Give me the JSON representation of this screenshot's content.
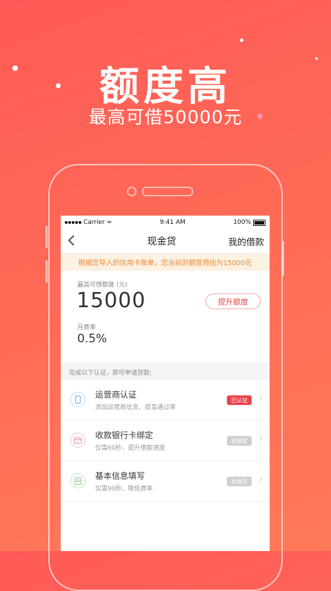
{
  "promo": {
    "headline": "额度高",
    "subline": "最高可借50000元"
  },
  "status_bar": {
    "carrier": "Carrier",
    "time": "9:41 AM",
    "battery": "100%"
  },
  "nav": {
    "back_icon": "chevron-left-icon",
    "title": "现金贷",
    "right_link": "我的借款"
  },
  "notice": "根据您导入的信用卡账单，您当前的额度预估为15000元",
  "quota": {
    "label": "最高可借额度 (元)",
    "amount": "15000",
    "rate_label": "月费率",
    "rate": "0.5%",
    "raise_button": "提升额度"
  },
  "section_hint": "完成以下认证，即可申请贷款:",
  "items": [
    {
      "title": "运营商认证",
      "desc": "添加运营商信息，提高通过率",
      "badge": "已认证",
      "icon": "phone-icon",
      "icon_color": "#5aa9e6",
      "badge_color": "#e8454e"
    },
    {
      "title": "收款银行卡绑定",
      "desc": "仅需60秒，提升借款速度",
      "badge": "未绑定",
      "icon": "bank-card-icon",
      "icon_color": "#e88a8a",
      "badge_color": "#cfcfcf"
    },
    {
      "title": "基本信息填写",
      "desc": "仅需90秒，降低费率",
      "badge": "未填写",
      "icon": "document-icon",
      "icon_color": "#7cc27c",
      "badge_color": "#cfcfcf"
    }
  ]
}
